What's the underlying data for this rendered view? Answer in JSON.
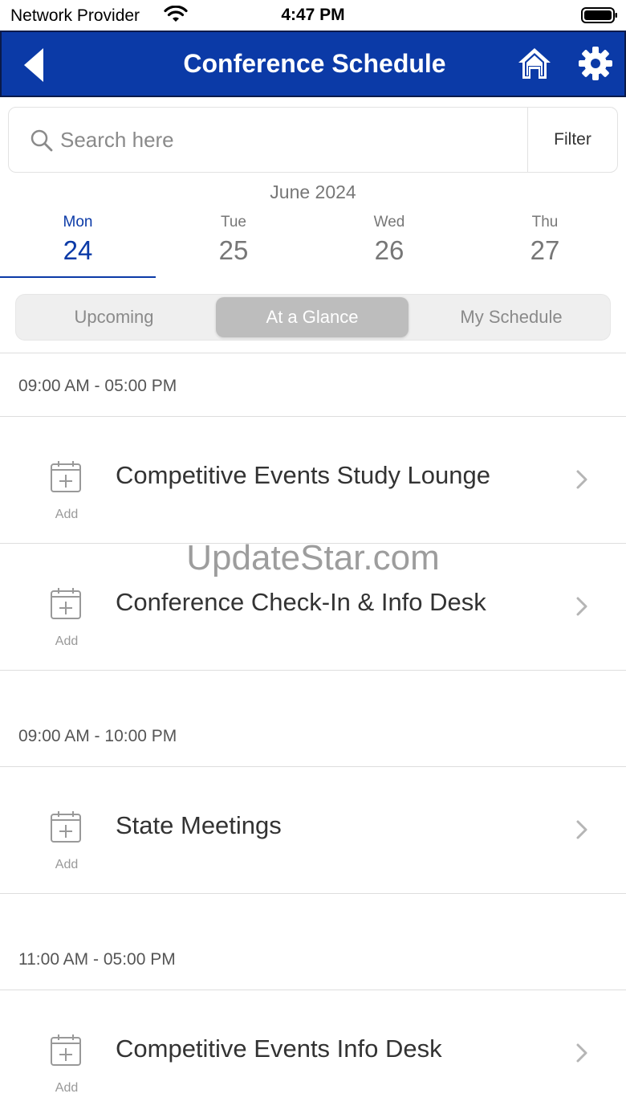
{
  "status_bar": {
    "provider": "Network Provider",
    "time": "4:47 PM"
  },
  "nav": {
    "title": "Conference Schedule",
    "accent_color": "#0b3aa7"
  },
  "search": {
    "placeholder": "Search here",
    "value": "",
    "filter_label": "Filter"
  },
  "calendar": {
    "month": "June 2024",
    "days": [
      {
        "name": "Mon",
        "num": "24",
        "selected": true
      },
      {
        "name": "Tue",
        "num": "25",
        "selected": false
      },
      {
        "name": "Wed",
        "num": "26",
        "selected": false
      },
      {
        "name": "Thu",
        "num": "27",
        "selected": false
      }
    ]
  },
  "segments": {
    "items": [
      "Upcoming",
      "At a Glance",
      "My Schedule"
    ],
    "selected": "At a Glance"
  },
  "groups": [
    {
      "time": "09:00 AM - 05:00 PM",
      "events": [
        {
          "title": "Competitive Events Study Lounge",
          "add_label": "Add"
        },
        {
          "title": "Conference Check-In & Info Desk",
          "add_label": "Add"
        }
      ]
    },
    {
      "time": "09:00 AM - 10:00 PM",
      "events": [
        {
          "title": "State Meetings",
          "add_label": "Add"
        }
      ]
    },
    {
      "time": "11:00 AM - 05:00 PM",
      "events": [
        {
          "title": "Competitive Events Info Desk",
          "add_label": "Add"
        }
      ]
    }
  ],
  "watermark": "UpdateStar.com",
  "icons": [
    "wifi-icon",
    "battery-icon",
    "back-icon",
    "home-icon",
    "gear-icon",
    "search-icon",
    "calendar-add-icon",
    "chevron-right-icon"
  ]
}
